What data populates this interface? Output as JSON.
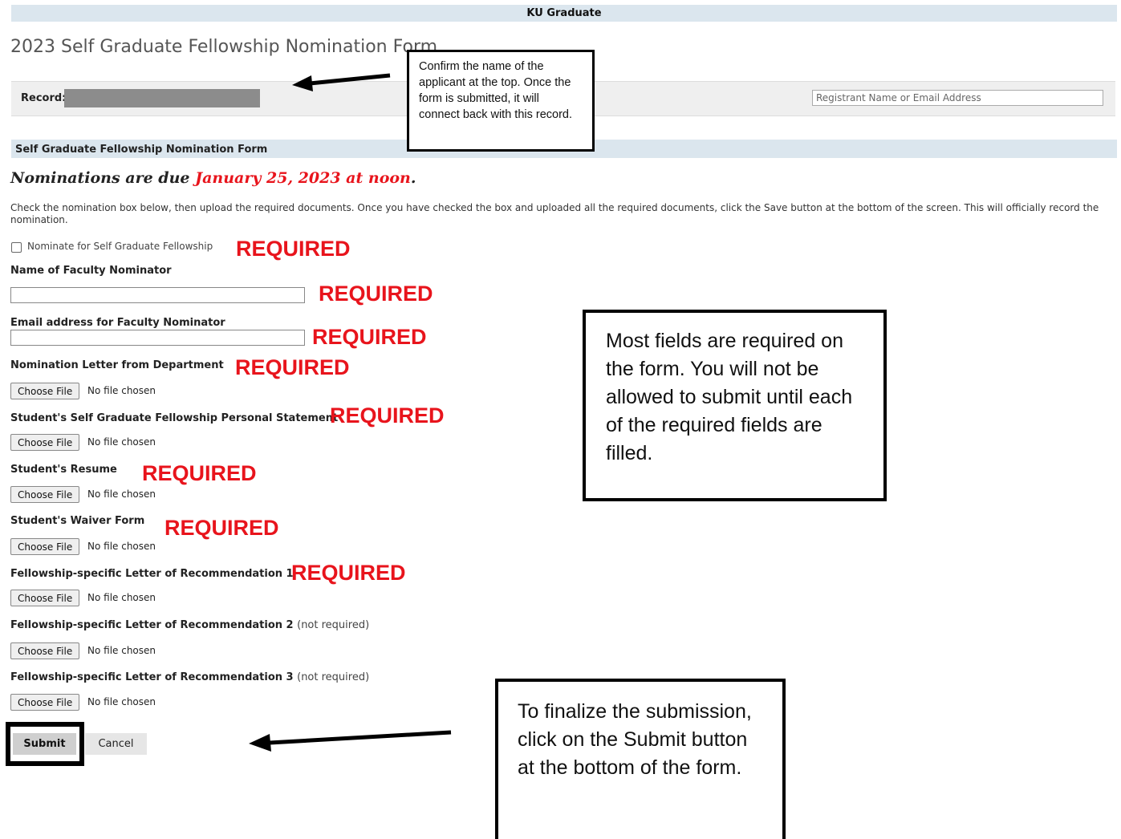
{
  "header": {
    "title": "KU Graduate"
  },
  "page": {
    "title": "2023 Self Graduate Fellowship Nomination Form"
  },
  "record": {
    "label": "Record:",
    "search_placeholder": "Registrant Name or Email Address"
  },
  "section": {
    "title": "Self Graduate Fellowship Nomination Form"
  },
  "due": {
    "prefix": "Nominations are due ",
    "date": "January 25, 2023 at noon",
    "suffix": "."
  },
  "instructions": "Check the nomination box below, then upload the required documents. Once you have checked the box and uploaded all the required documents, click the Save button at the bottom of the screen. This will officially record the nomination.",
  "required_text": "REQUIRED",
  "nominate_checkbox_label": "Nominate for Self Graduate Fellowship",
  "fields": {
    "faculty_name": "Name of Faculty Nominator",
    "faculty_email": "Email address for Faculty Nominator"
  },
  "uploads": [
    {
      "label": "Nomination Letter from Department",
      "note": ""
    },
    {
      "label": "Student's Self Graduate Fellowship Personal Statement",
      "note": ""
    },
    {
      "label": "Student's Resume",
      "note": ""
    },
    {
      "label": "Student's Waiver Form",
      "note": ""
    },
    {
      "label": "Fellowship-specific Letter of Recommendation 1",
      "note": ""
    },
    {
      "label": "Fellowship-specific Letter of Recommendation 2",
      "note": "(not required)"
    },
    {
      "label": "Fellowship-specific Letter of Recommendation 3",
      "note": "(not required)"
    }
  ],
  "file_button_label": "Choose File",
  "no_file_text": "No file chosen",
  "buttons": {
    "submit": "Submit",
    "cancel": "Cancel"
  },
  "callouts": {
    "record": "Confirm the name of the applicant at the top. Once the form is submitted, it will connect back with this record.",
    "required": "Most fields are required on the form. You will not be allowed to submit until each of the required fields are filled.",
    "submit": "To finalize the submission, click on the Submit button at the bottom of the form."
  },
  "colors": {
    "required_red": "#e8141c",
    "header_bg": "#dbe6ee"
  }
}
